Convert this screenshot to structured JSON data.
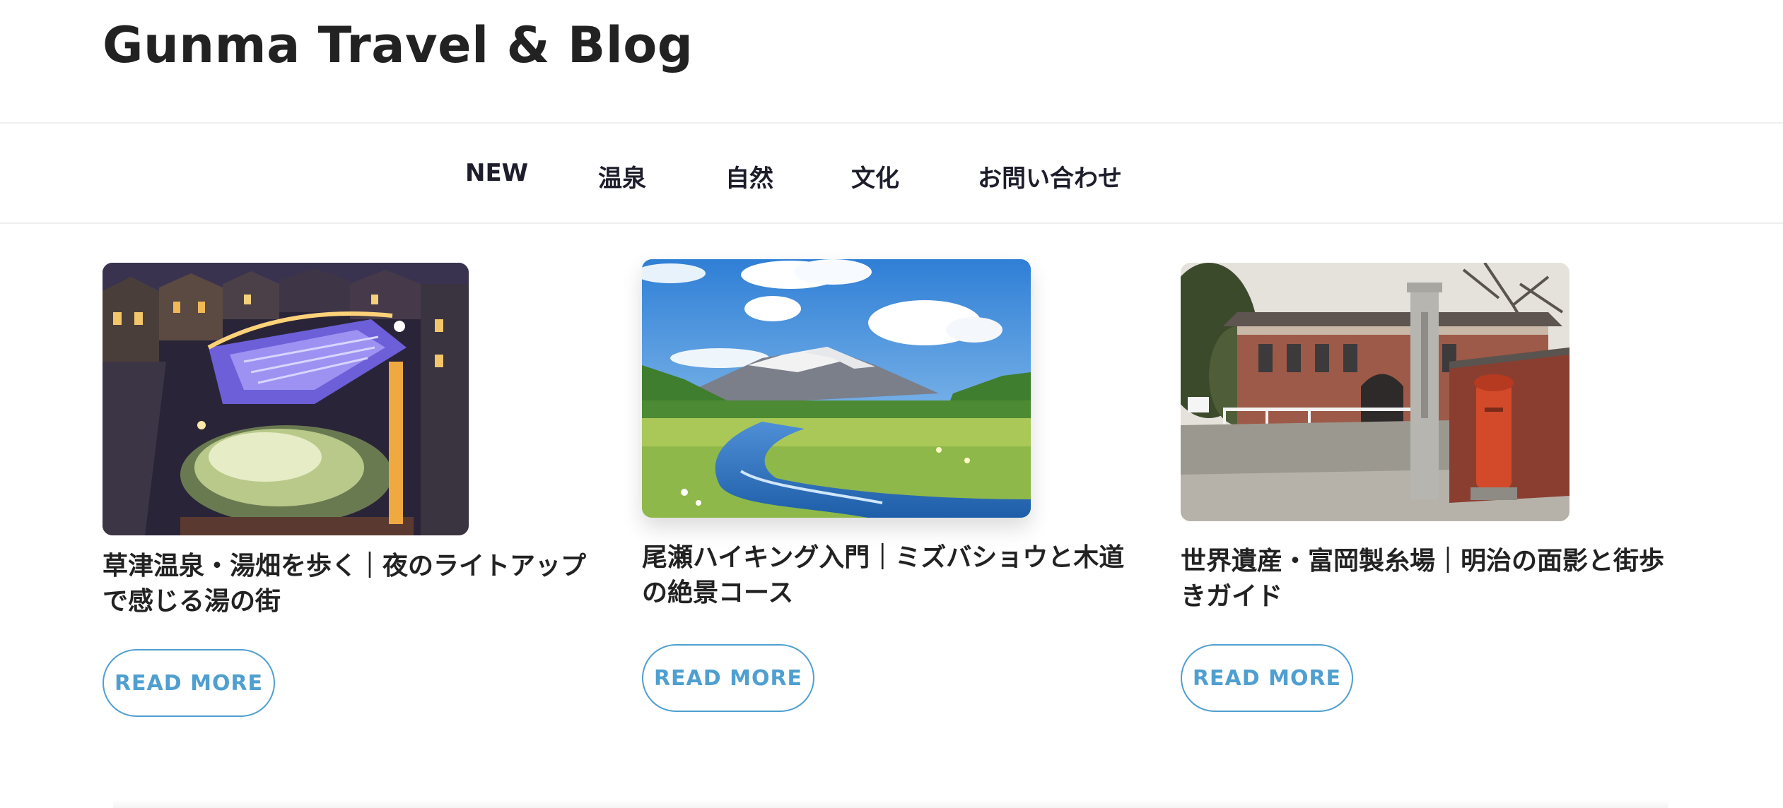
{
  "site": {
    "title": "Gunma Travel & Blog"
  },
  "nav": {
    "items": [
      {
        "label": "NEW"
      },
      {
        "label": "温泉"
      },
      {
        "label": "自然"
      },
      {
        "label": "文化"
      },
      {
        "label": "お問い合わせ"
      }
    ]
  },
  "posts": [
    {
      "title": "草津温泉・湯畑を歩く｜夜のライトアップで感じる湯の街",
      "button": "READ MORE",
      "image": "kusatsu-yubatake-night-photo"
    },
    {
      "title": "尾瀬ハイキング入門｜ミズバショウと木道の絶景コース",
      "button": "READ MORE",
      "image": "oze-marsh-mountain-photo"
    },
    {
      "title": "世界遺産・富岡製糸場｜明治の面影と街歩きガイド",
      "button": "READ MORE",
      "image": "tomioka-silk-mill-gate-photo"
    }
  ],
  "colors": {
    "accent": "#4f9fd0",
    "text": "#222222",
    "nav_text": "#1d1d2b",
    "divider": "#eeeeee"
  }
}
